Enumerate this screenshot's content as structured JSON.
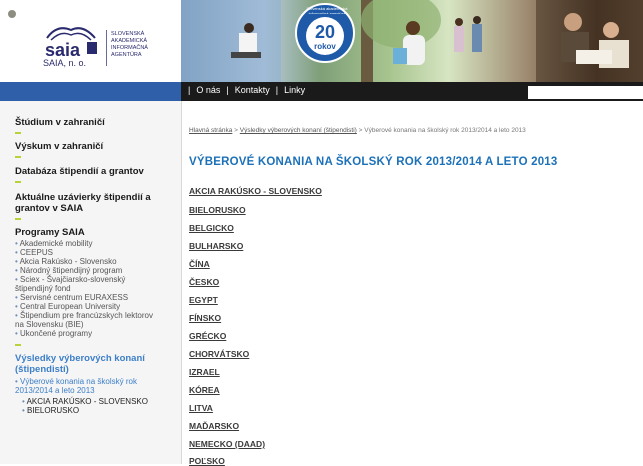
{
  "header": {
    "logo_name": "SAIA, n. o.",
    "logo_org": [
      "SLOVENSKÁ",
      "AKADEMICKÁ",
      "INFORMAČNÁ",
      "AGENTÚRA"
    ],
    "badge_number": "20",
    "badge_unit": "rokov",
    "badge_ring": "Slovenská akademická informačná agentúra"
  },
  "nav": {
    "links": [
      "O nás",
      "Kontakty",
      "Linky"
    ],
    "separator": "|"
  },
  "sidebar": {
    "headings": [
      "Štúdium v zahraničí",
      "Výskum v zahraničí",
      "Databáza štipendií a grantov",
      "Aktuálne uzávierky štipendií a grantov v SAIA"
    ],
    "programs_title": "Programy SAIA",
    "programs": [
      "Akademické mobility",
      "CEEPUS",
      "Akcia Rakúsko - Slovensko",
      "Národný štipendijný program",
      "Sciex - Švajčiarsko-slovenský štipendijný fond",
      "Servisné centrum EURAXESS",
      "Central European University",
      "Štipendium pre francúzskych lektorov na Slovensku (BIE)",
      "Ukončené programy"
    ],
    "results_title": "Výsledky výberových konaní (štipendistí)",
    "results_active": "Výberové konania na školský rok 2013/2014 a leto 2013",
    "results_sub": [
      "AKCIA RAKÚSKO - SLOVENSKO",
      "BIELORUSKO"
    ]
  },
  "main": {
    "breadcrumb": {
      "home": "Hlavná stránka",
      "sep": ">",
      "results": "Výsledky výberových konaní (štipendisti)",
      "current": "Výberové konania na školský rok 2013/2014 a leto 2013"
    },
    "title": "VÝBEROVÉ KONANIA NA ŠKOLSKÝ ROK 2013/2014 A LETO 2013",
    "countries": [
      "AKCIA RAKÚSKO - SLOVENSKO",
      "BIELORUSKO",
      "BELGICKO",
      "BULHARSKO",
      "ČÍNA",
      "ČESKO",
      "EGYPT",
      "FÍNSKO",
      "GRÉCKO",
      "CHORVÁTSKO",
      "IZRAEL",
      "KÓREA",
      "LITVA",
      "MAĎARSKO",
      "NEMECKO (DAAD)",
      "POĽSKO"
    ]
  },
  "colors": {
    "title_blue": "#1c71b8",
    "nav_dark": "#1a1a1a",
    "nav_blue": "#2f5fa8",
    "accent_green": "#b8d23a",
    "badge_blue": "#1e5aa8"
  }
}
